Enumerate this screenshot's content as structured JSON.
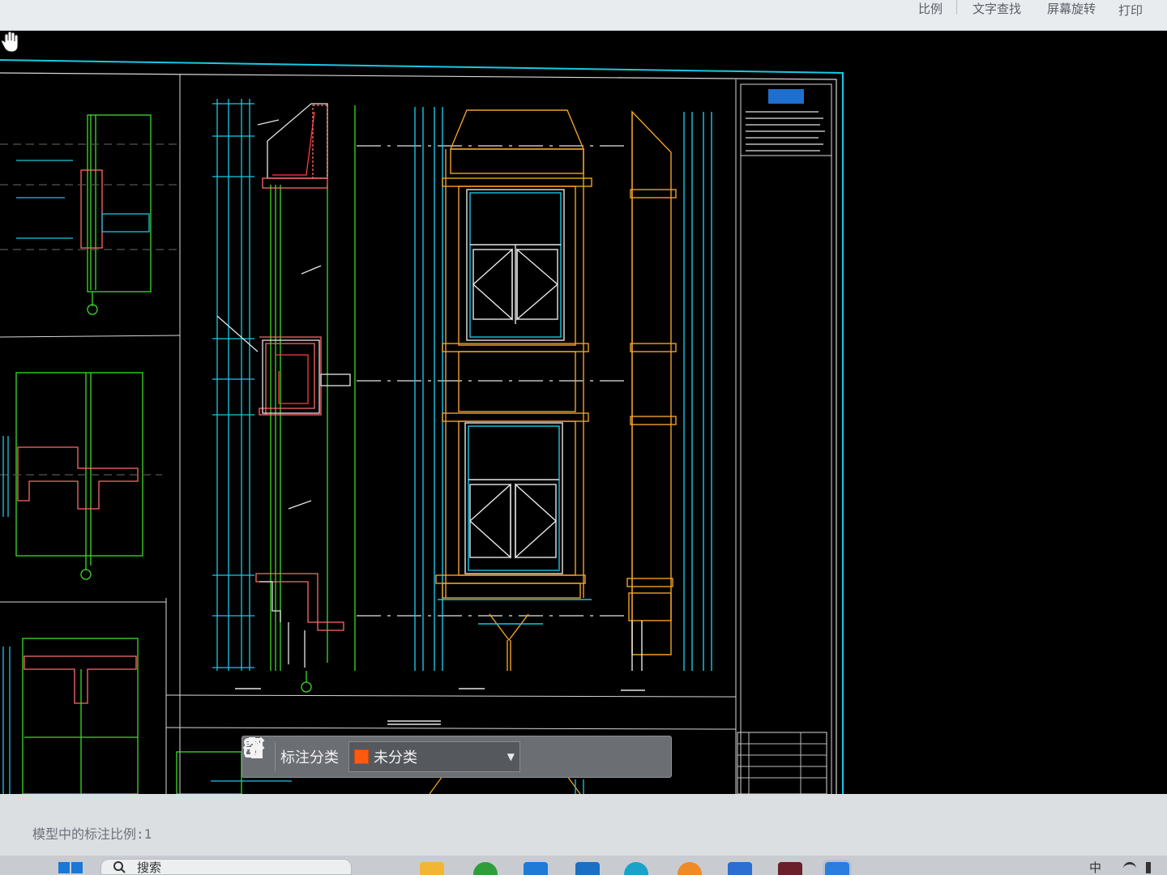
{
  "toolbar": {
    "items": [
      "比例",
      "文字查找",
      "屏幕旋转",
      "打印"
    ]
  },
  "annotation_bar": {
    "category_label": "标注分类",
    "category_value": "未分类",
    "category_color": "#ff5a10"
  },
  "statusbar": {
    "annotation_scale": "模型中的标注比例:1"
  },
  "taskbar": {
    "search_placeholder": "搜索",
    "tray_ime": "中"
  },
  "colors": {
    "canvas_bg": "#000000",
    "frame_cyan": "#19c8e6",
    "line_green": "#3cdc28",
    "line_orange": "#f0a028",
    "line_white": "#e6e6e6",
    "line_red": "#ff3c3c"
  }
}
